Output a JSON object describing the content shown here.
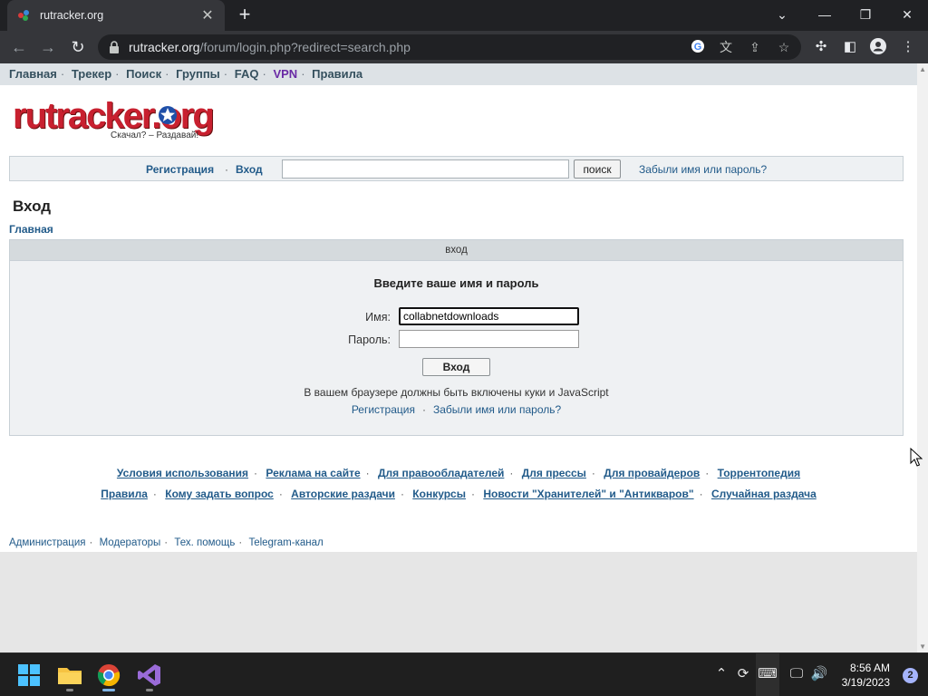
{
  "browser": {
    "tab_title": "rutracker.org",
    "url_host": "rutracker.org",
    "url_path": "/forum/login.php?redirect=search.php"
  },
  "topnav": {
    "items": [
      {
        "label": "Главная"
      },
      {
        "label": "Трекер"
      },
      {
        "label": "Поиск"
      },
      {
        "label": "Группы"
      },
      {
        "label": "FAQ"
      },
      {
        "label": "VPN"
      },
      {
        "label": "Правила"
      }
    ]
  },
  "logo": {
    "text": "rutracker.org",
    "tagline": "Скачал? – Раздавай!"
  },
  "loginbar": {
    "register": "Регистрация",
    "login": "Вход",
    "search_button": "поиск",
    "forgot": "Забыли имя или пароль?"
  },
  "page": {
    "title": "Вход",
    "breadcrumb": "Главная"
  },
  "login_form": {
    "header": "вход",
    "prompt": "Введите ваше имя и пароль",
    "username_label": "Имя:",
    "username_value": "collabnetdownloads",
    "password_label": "Пароль:",
    "password_value": "",
    "submit_label": "Вход",
    "cookie_note": "В вашем браузере должны быть включены куки и JavaScript",
    "register_link": "Регистрация",
    "forgot_link": "Забыли имя или пароль?"
  },
  "footer": {
    "row1": [
      "Условия использования",
      "Реклама на сайте",
      "Для правообладателей",
      "Для прессы",
      "Для провайдеров",
      "Торрентопедия"
    ],
    "row2": [
      "Правила",
      "Кому задать вопрос",
      "Авторские раздачи",
      "Конкурсы",
      "Новости \"Хранителей\" и \"Антикваров\"",
      "Случайная раздача"
    ],
    "bottom": [
      "Администрация",
      "Модераторы",
      "Тех. помощь",
      "Telegram-канал"
    ]
  },
  "taskbar": {
    "time": "8:56 AM",
    "date": "3/19/2023",
    "notifications": "2"
  }
}
